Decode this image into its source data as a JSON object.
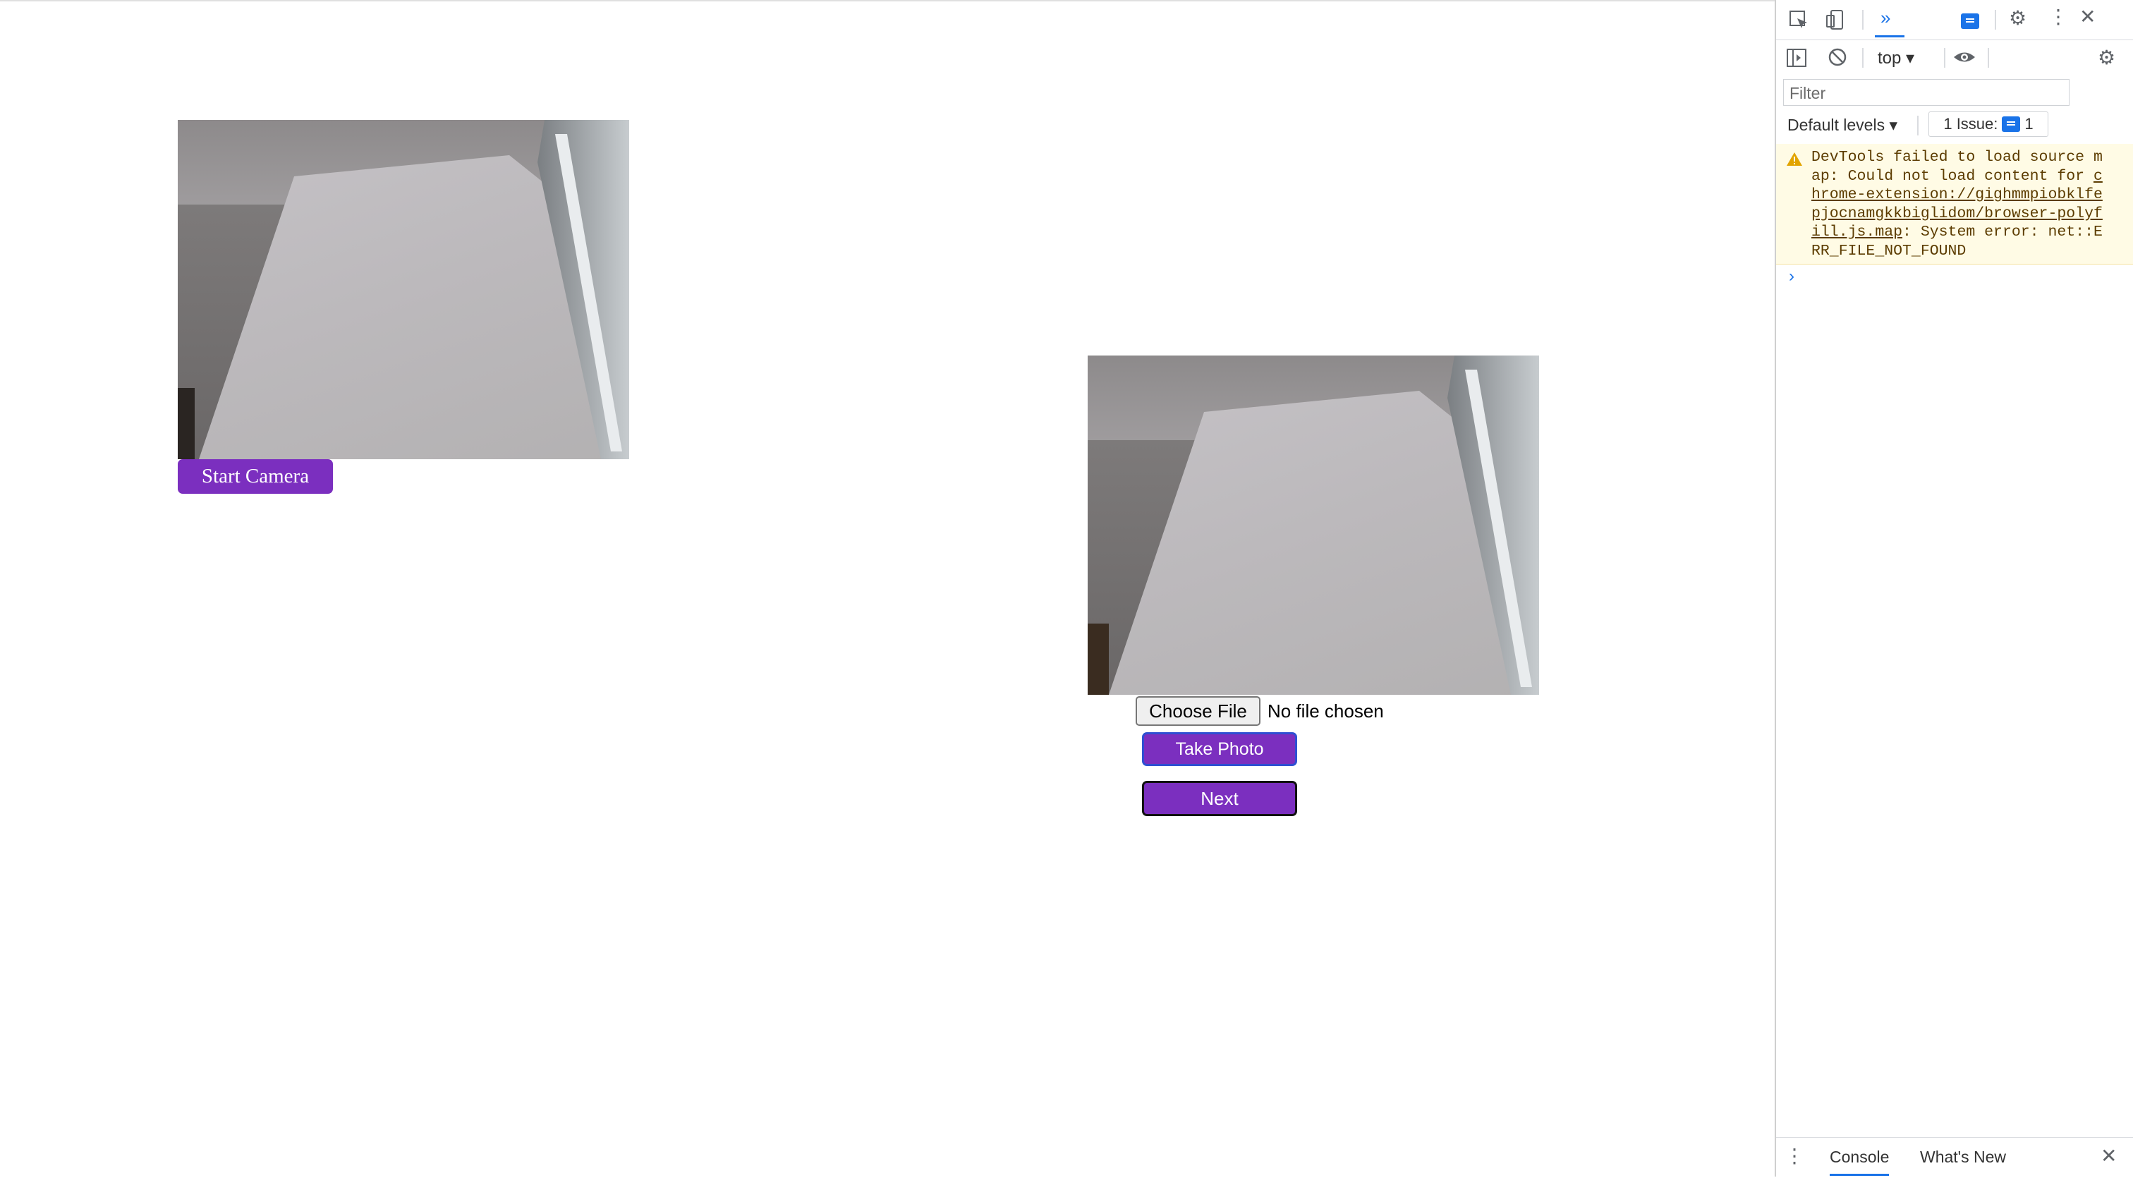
{
  "page": {
    "start_camera_label": "Start Camera",
    "choose_file_label": "Choose File",
    "no_file_text": "No file chosen",
    "take_photo_label": "Take Photo",
    "next_label": "Next",
    "accent_color": "#7b2fbf"
  },
  "devtools": {
    "context_label": "top",
    "filter_placeholder": "Filter",
    "levels_label": "Default levels",
    "issues_label": "1 Issue:",
    "issues_count": "1",
    "warning": {
      "prefix": "DevTools failed to load source map: Could not load content for ",
      "link": "chrome-extension://gighmmpiobklfepjocnamgkkbiglidom/browser-polyfill.js.map",
      "suffix": ": System error: net::ERR_FILE_NOT_FOUND"
    },
    "prompt_symbol": "›",
    "drawer_tabs": [
      "Console",
      "What's New"
    ]
  }
}
